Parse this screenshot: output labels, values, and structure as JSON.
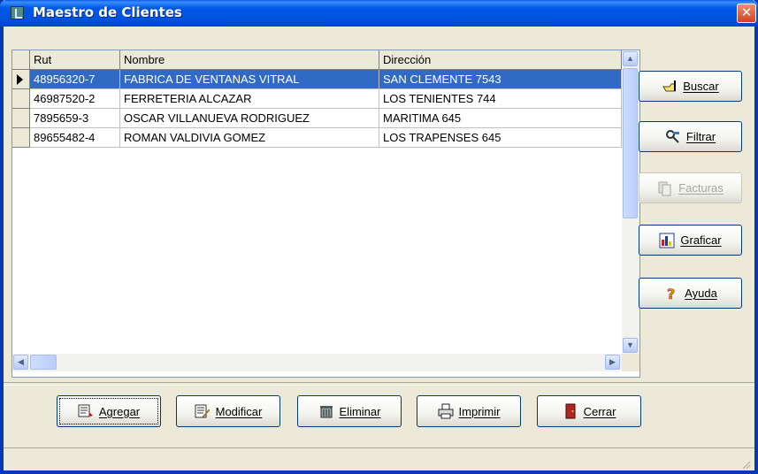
{
  "window": {
    "title": "Maestro de Clientes",
    "close_glyph": "✕"
  },
  "grid": {
    "columns": [
      "Rut",
      "Nombre",
      "Dirección"
    ],
    "rows": [
      {
        "rut": "48956320-7",
        "nombre": "FABRICA DE VENTANAS VITRAL",
        "direccion": "SAN CLEMENTE 7543",
        "selected": true
      },
      {
        "rut": "46987520-2",
        "nombre": "FERRETERIA ALCAZAR",
        "direccion": "LOS TENIENTES 744",
        "selected": false
      },
      {
        "rut": "7895659-3",
        "nombre": "OSCAR VILLANUEVA RODRIGUEZ",
        "direccion": "MARITIMA 645",
        "selected": false
      },
      {
        "rut": "89655482-4",
        "nombre": "ROMAN VALDIVIA GOMEZ",
        "direccion": "LOS TRAPENSES 645",
        "selected": false
      }
    ]
  },
  "side_buttons": {
    "buscar": {
      "label": "Buscar",
      "icon": "search-hand-icon"
    },
    "filtrar": {
      "label": "Filtrar",
      "icon": "filter-icon"
    },
    "facturas": {
      "label": "Facturas",
      "icon": "invoice-icon",
      "enabled": false
    },
    "graficar": {
      "label": "Graficar",
      "icon": "chart-icon"
    },
    "ayuda": {
      "label": "Ayuda",
      "icon": "help-icon"
    }
  },
  "bottom_buttons": {
    "agregar": {
      "label": "Agregar",
      "icon": "add-record-icon"
    },
    "modificar": {
      "label": "Modificar",
      "icon": "edit-record-icon"
    },
    "eliminar": {
      "label": "Eliminar",
      "icon": "trash-icon"
    },
    "imprimir": {
      "label": "Imprimir",
      "icon": "printer-icon"
    },
    "cerrar": {
      "label": "Cerrar",
      "icon": "door-icon"
    }
  },
  "colors": {
    "selection": "#316ac5",
    "titlebar": "#0054e3",
    "dialog_bg": "#ece9d8"
  }
}
